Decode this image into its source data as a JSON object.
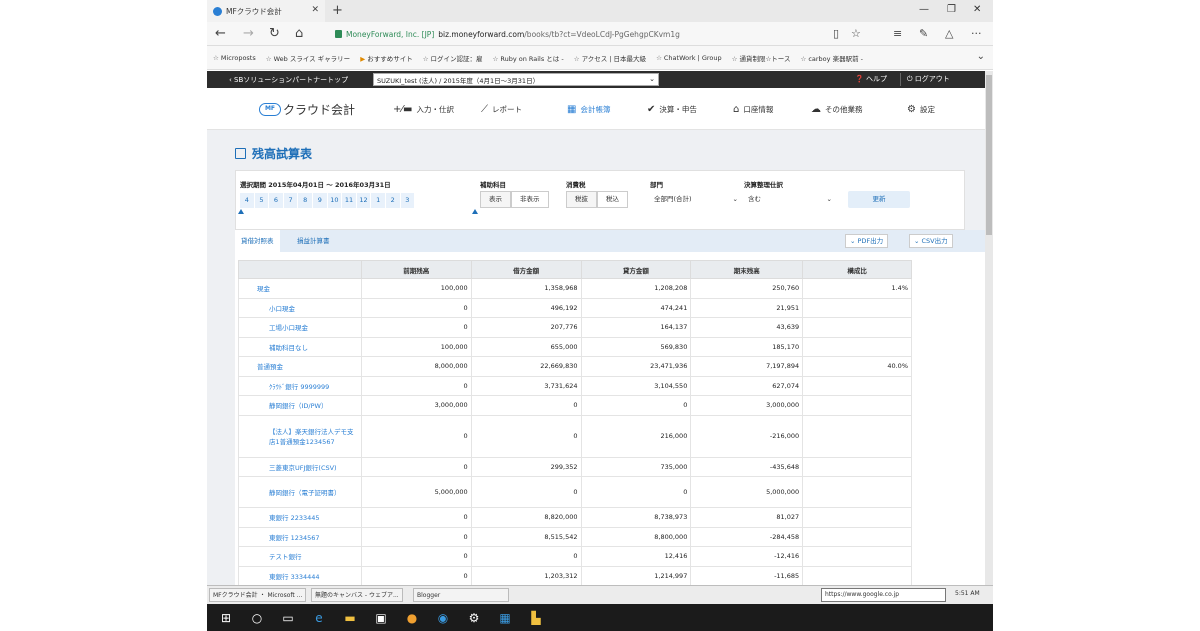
{
  "browser": {
    "tab_title": "MFクラウド会計",
    "org": "MoneyForward, Inc. [JP]",
    "url_host": "biz.moneyforward.com",
    "url_path": "/books/tb?ct=VdeoLCdJ-PgGehgpCKvm1g",
    "favorites": [
      "Microposts",
      "Web スライス ギャラリー",
      "おすすめサイト",
      "ログイン認証：雇",
      "Ruby on Rails とは -",
      "アクセス | 日本最大級",
      "ChatWork | Group",
      "通貨制限☆トース",
      "carboy 楽器駅前 -"
    ]
  },
  "topbar": {
    "back": "‹ SBソリューションパートナートップ",
    "company": "SUZUKI_test (法人) / 2015年度（4月1日〜3月31日）",
    "help": "❓ ヘルプ",
    "logout": "⏻ ログアウト"
  },
  "nav": {
    "logo": "クラウド会計",
    "logo_mark": "MF",
    "items": [
      "入力・仕訳",
      "レポート",
      "会計帳簿",
      "決算・申告",
      "口座情報",
      "その他業務",
      "設定"
    ]
  },
  "page": {
    "title": "残高試算表",
    "period_label": "選択期間 2015年04月01日 〜 2016年03月31日",
    "months": [
      "4",
      "5",
      "6",
      "7",
      "8",
      "9",
      "10",
      "11",
      "12",
      "1",
      "2",
      "3"
    ],
    "aux_label": "補助科目",
    "aux_options": [
      "表示",
      "非表示"
    ],
    "tax_label": "消費税",
    "tax_options": [
      "税抜",
      "税込"
    ],
    "dept_label": "部門",
    "dept_value": "全部門(合計)",
    "closing_label": "決算整理仕訳",
    "closing_value": "含む",
    "update": "更新",
    "tabs": [
      "貸借対照表",
      "損益計算書"
    ],
    "pdf": "PDF出力",
    "csv": "CSV出力"
  },
  "table": {
    "headers": [
      "",
      "前期残高",
      "借方金額",
      "貸方金額",
      "期末残高",
      "構成比"
    ],
    "rows": [
      {
        "name": "現金",
        "prev": "100,000",
        "debit": "1,358,968",
        "credit": "1,208,208",
        "end": "250,760",
        "ratio": "1.4%"
      },
      {
        "name": "小口現金",
        "prev": "0",
        "debit": "496,192",
        "credit": "474,241",
        "end": "21,951",
        "ratio": ""
      },
      {
        "name": "工場小口現金",
        "prev": "0",
        "debit": "207,776",
        "credit": "164,137",
        "end": "43,639",
        "ratio": ""
      },
      {
        "name": "補助科目なし",
        "prev": "100,000",
        "debit": "655,000",
        "credit": "569,830",
        "end": "185,170",
        "ratio": ""
      },
      {
        "name": "普通預金",
        "prev": "8,000,000",
        "debit": "22,669,830",
        "credit": "23,471,936",
        "end": "7,197,894",
        "ratio": "40.0%"
      },
      {
        "name": "ｸﾗｳﾄﾞ銀行 9999999",
        "prev": "0",
        "debit": "3,731,624",
        "credit": "3,104,550",
        "end": "627,074",
        "ratio": ""
      },
      {
        "name": "静岡銀行（ID/PW）",
        "prev": "3,000,000",
        "debit": "0",
        "credit": "0",
        "end": "3,000,000",
        "ratio": ""
      },
      {
        "name": "【法人】楽天銀行法人デモ支店1普通預金1234567",
        "prev": "0",
        "debit": "0",
        "credit": "216,000",
        "end": "-216,000",
        "ratio": ""
      },
      {
        "name": "三菱東京UFJ銀行(CSV)",
        "prev": "0",
        "debit": "299,352",
        "credit": "735,000",
        "end": "-435,648",
        "ratio": ""
      },
      {
        "name": "静岡銀行（電子証明書）",
        "prev": "5,000,000",
        "debit": "0",
        "credit": "0",
        "end": "5,000,000",
        "ratio": ""
      },
      {
        "name": "東銀行 2233445",
        "prev": "0",
        "debit": "8,820,000",
        "credit": "8,738,973",
        "end": "81,027",
        "ratio": ""
      },
      {
        "name": "東銀行 1234567",
        "prev": "0",
        "debit": "8,515,542",
        "credit": "8,800,000",
        "end": "-284,458",
        "ratio": ""
      },
      {
        "name": "テスト銀行",
        "prev": "0",
        "debit": "0",
        "credit": "12,416",
        "end": "-12,416",
        "ratio": ""
      },
      {
        "name": "東銀行 3334444",
        "prev": "0",
        "debit": "1,203,312",
        "credit": "1,214,997",
        "end": "-11,685",
        "ratio": ""
      }
    ]
  },
  "taskbar": {
    "items": [
      "MFクラウド会計 ・ Microsoft ...",
      "無題のキャンバス - ウェブア...",
      "Blogger"
    ],
    "url": "https://www.google.co.jp",
    "time": "5:51 AM"
  }
}
